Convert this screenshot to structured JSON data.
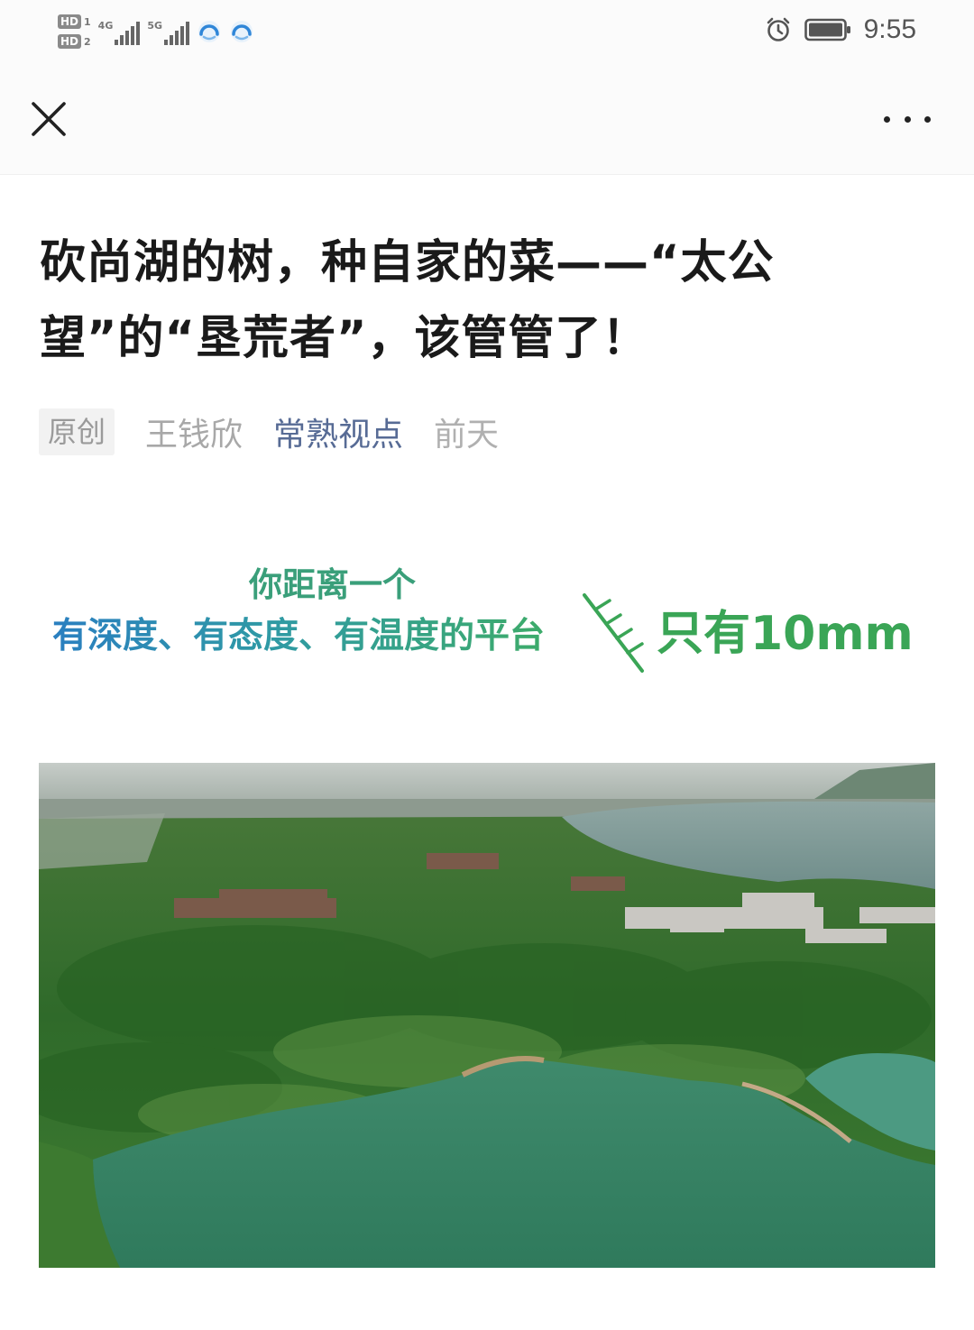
{
  "status_bar": {
    "hd1": "HD",
    "hd1_num": "1",
    "hd2": "HD",
    "hd2_num": "2",
    "network1": "4G",
    "network2": "5G",
    "time": "9:55",
    "icons": [
      "alarm-icon",
      "battery-icon"
    ]
  },
  "nav": {
    "close_icon": "close-icon",
    "more_icon": "more-icon"
  },
  "article": {
    "title": "砍尚湖的树，种自家的菜——“太公望”的“垦荒者”，该管管了！",
    "tag": "原创",
    "author": "王钱欣",
    "account": "常熟视点",
    "date": "前天"
  },
  "banner": {
    "line1": "你距离一个",
    "line2": "有深度、有态度、有温度的平台",
    "slogan": "只有10mm"
  },
  "colors": {
    "link": "#576b95",
    "banner_green": "#3aa556",
    "banner_blue": "#2a7fc0"
  }
}
